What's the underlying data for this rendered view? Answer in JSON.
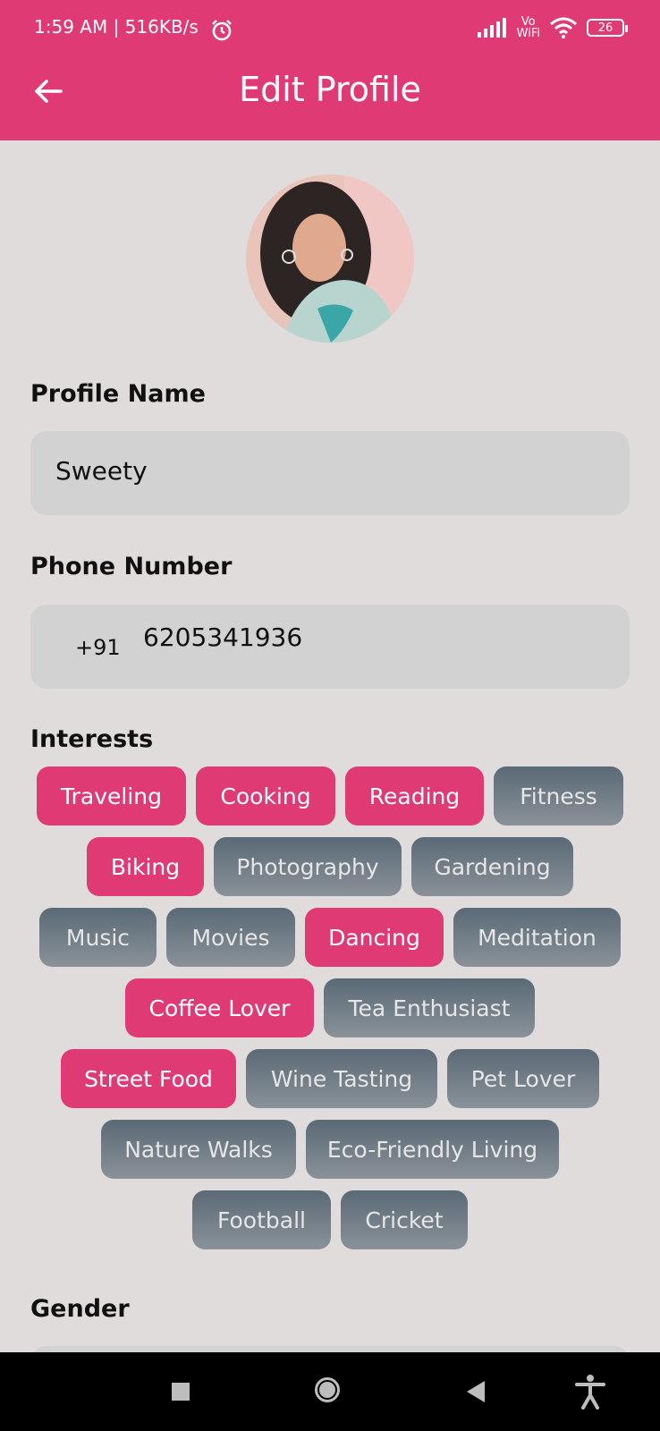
{
  "status_bar": {
    "time": "1:59 AM | 516KB/s",
    "network_label_top": "Vo",
    "network_label_bottom": "WiFi",
    "battery": "26"
  },
  "header": {
    "title": "Edit Profile"
  },
  "profile_name": {
    "label": "Profile Name",
    "value": "Sweety"
  },
  "phone": {
    "label": "Phone Number",
    "country_code": "+91",
    "value": "6205341936"
  },
  "interests": {
    "label": "Interests",
    "items": [
      {
        "label": "Traveling",
        "selected": true
      },
      {
        "label": "Cooking",
        "selected": true
      },
      {
        "label": "Reading",
        "selected": true
      },
      {
        "label": "Fitness",
        "selected": false
      },
      {
        "label": "Biking",
        "selected": true
      },
      {
        "label": "Photography",
        "selected": false
      },
      {
        "label": "Gardening",
        "selected": false
      },
      {
        "label": "Music",
        "selected": false
      },
      {
        "label": "Movies",
        "selected": false
      },
      {
        "label": "Dancing",
        "selected": true
      },
      {
        "label": "Meditation",
        "selected": false
      },
      {
        "label": "Coffee Lover",
        "selected": true
      },
      {
        "label": "Tea Enthusiast",
        "selected": false
      },
      {
        "label": "Street Food",
        "selected": true
      },
      {
        "label": "Wine Tasting",
        "selected": false
      },
      {
        "label": "Pet Lover",
        "selected": false
      },
      {
        "label": "Nature Walks",
        "selected": false
      },
      {
        "label": "Eco-Friendly Living",
        "selected": false
      },
      {
        "label": "Football",
        "selected": false
      },
      {
        "label": "Cricket",
        "selected": false
      }
    ]
  },
  "gender": {
    "label": "Gender"
  },
  "colors": {
    "accent": "#e03a74",
    "chip_off_top": "#5a6a76",
    "chip_off_bottom": "#8a9198",
    "background": "#e0dcdc",
    "field": "#d2d2d2"
  }
}
